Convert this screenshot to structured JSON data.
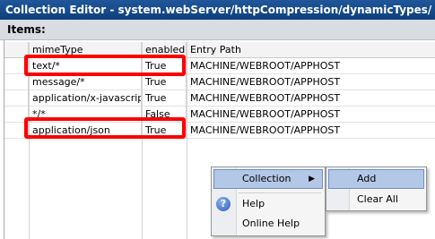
{
  "window": {
    "title": "Collection Editor - system.webServer/httpCompression/dynamicTypes/"
  },
  "items_header": "Items:",
  "grid": {
    "columns": [
      "mimeType",
      "enabled",
      "Entry Path"
    ],
    "rows": [
      {
        "mimeType": "text/*",
        "enabled": "True",
        "entryPath": "MACHINE/WEBROOT/APPHOST"
      },
      {
        "mimeType": "message/*",
        "enabled": "True",
        "entryPath": "MACHINE/WEBROOT/APPHOST"
      },
      {
        "mimeType": "application/x-javascript",
        "enabled": "True",
        "entryPath": "MACHINE/WEBROOT/APPHOST"
      },
      {
        "mimeType": "*/*",
        "enabled": "False",
        "entryPath": "MACHINE/WEBROOT/APPHOST"
      },
      {
        "mimeType": "application/json",
        "enabled": "True",
        "entryPath": "MACHINE/WEBROOT/APPHOST"
      }
    ],
    "highlighted_rows": [
      "text/*",
      "application/json"
    ],
    "highlight_color": "#ff0000"
  },
  "context_menu": {
    "items": [
      {
        "label": "Collection",
        "has_submenu": true,
        "selected": true
      },
      {
        "label": "Help",
        "icon": "help-icon"
      },
      {
        "label": "Online Help"
      }
    ]
  },
  "submenu": {
    "items": [
      {
        "label": "Add",
        "selected": true
      },
      {
        "label": "Clear All"
      }
    ]
  },
  "colors": {
    "titlebar": "#0e3f7c",
    "selection": "#b3c7e6"
  }
}
